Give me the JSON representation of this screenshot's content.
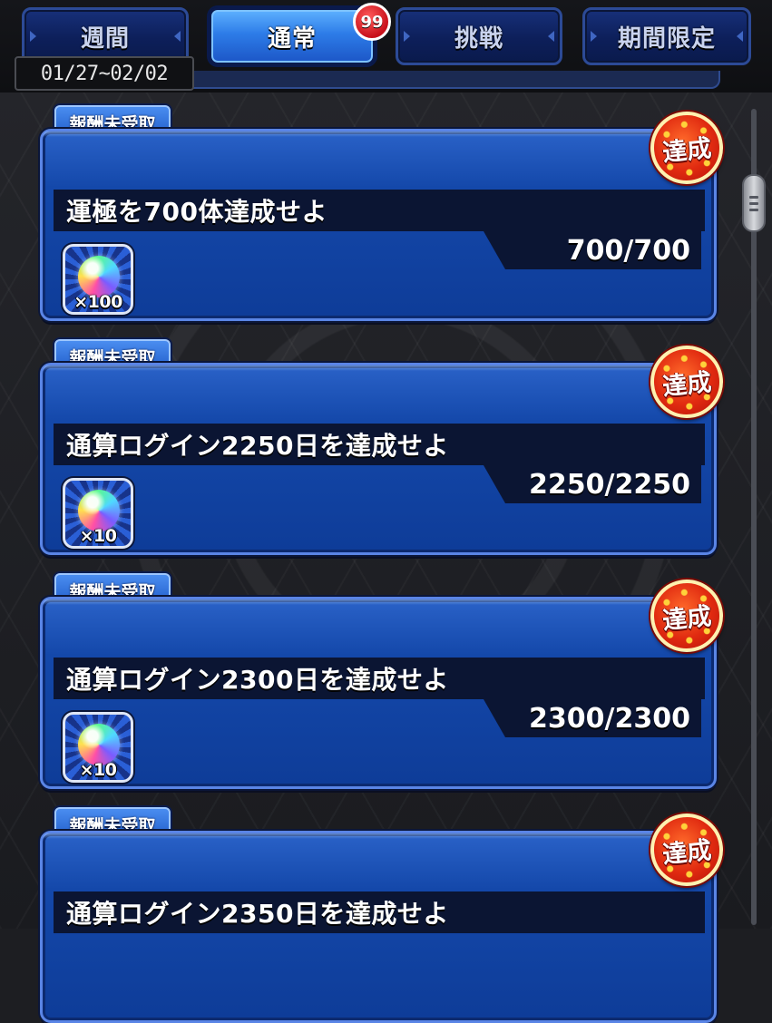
{
  "tabs": [
    {
      "label": "週間",
      "active": false
    },
    {
      "label": "通常",
      "active": true
    },
    {
      "label": "挑戦",
      "active": false
    },
    {
      "label": "期間限定",
      "active": false
    }
  ],
  "tab_badge": "99",
  "date_range": "01/27~02/02",
  "missions": [
    {
      "status_label": "報酬未受取",
      "achieved_label": "達成",
      "title": "運極を700体達成せよ",
      "progress": "700/700",
      "reward_qty": "×100",
      "reward_icon": "rainbow-orb-icon"
    },
    {
      "status_label": "報酬未受取",
      "achieved_label": "達成",
      "title": "通算ログイン2250日を達成せよ",
      "progress": "2250/2250",
      "reward_qty": "×10",
      "reward_icon": "rainbow-orb-icon"
    },
    {
      "status_label": "報酬未受取",
      "achieved_label": "達成",
      "title": "通算ログイン2300日を達成せよ",
      "progress": "2300/2300",
      "reward_qty": "×10",
      "reward_icon": "rainbow-orb-icon"
    },
    {
      "status_label": "報酬未受取",
      "achieved_label": "達成",
      "title": "通算ログイン2350日を達成せよ",
      "progress": "",
      "reward_qty": "",
      "reward_icon": "rainbow-orb-icon"
    }
  ],
  "colors": {
    "accent": "#2d7ce8",
    "card": "#1448aa",
    "badge": "#e02a10"
  }
}
